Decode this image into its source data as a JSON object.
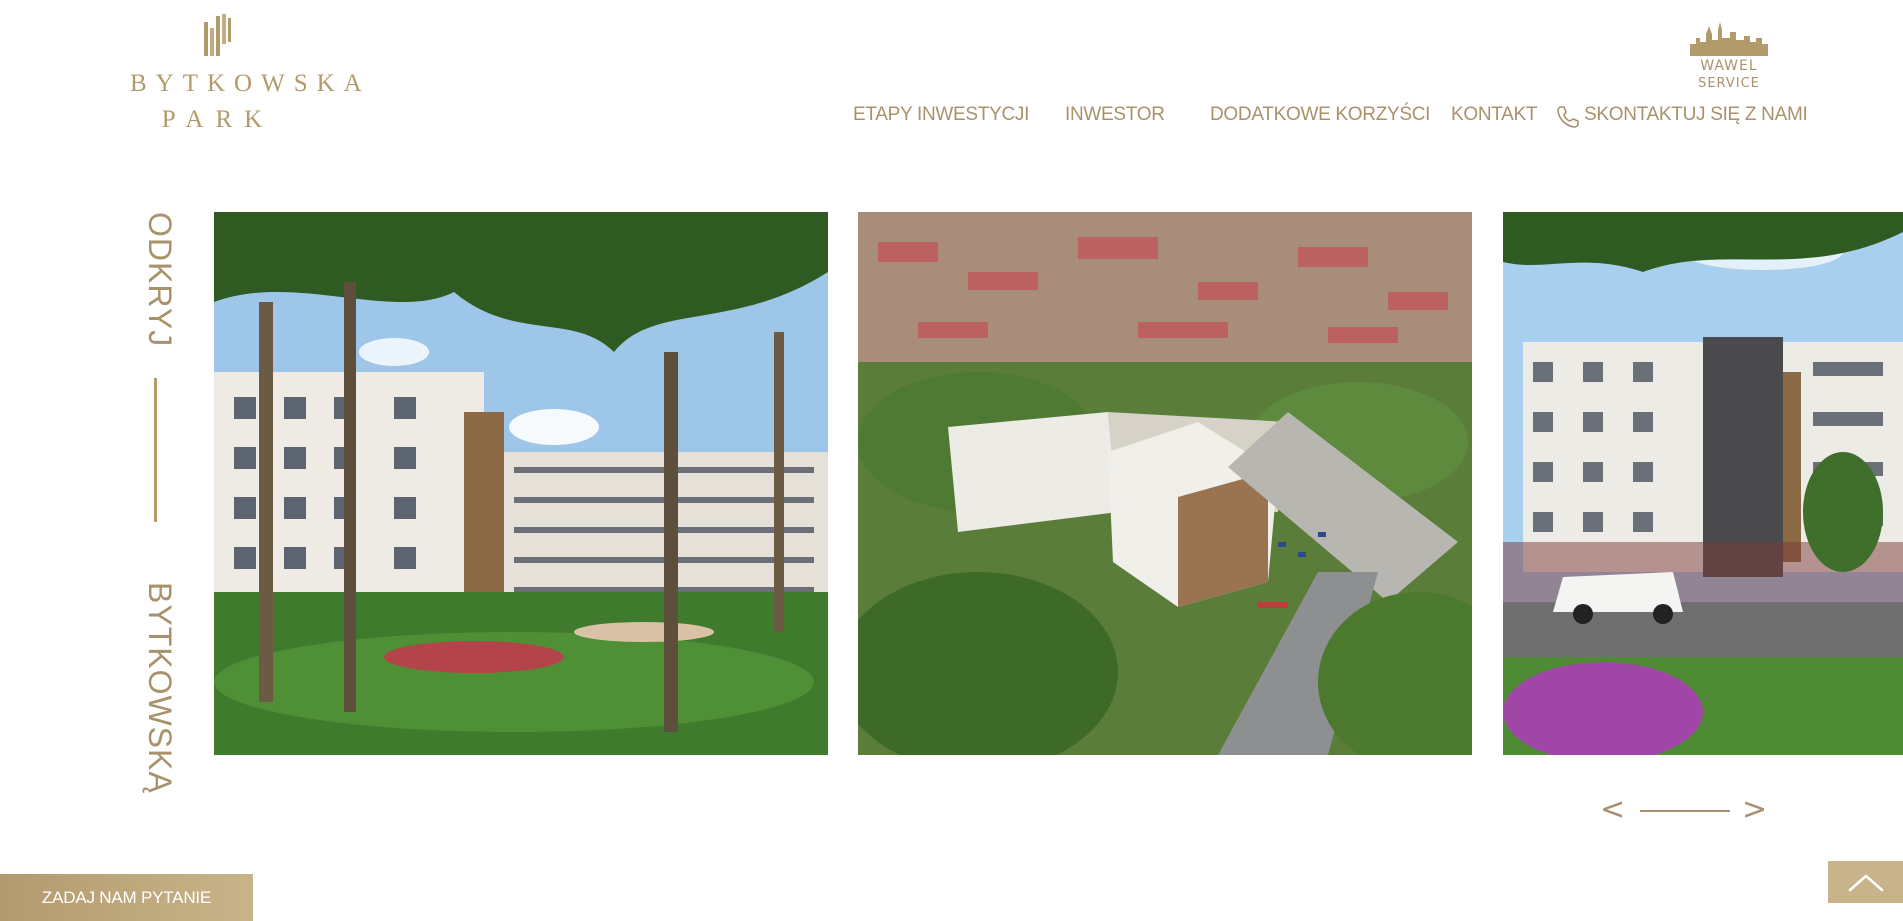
{
  "brand": {
    "name_line1": "BYTKOWSKA",
    "name_line2": "PARK",
    "partner_line1": "WAWEL",
    "partner_line2": "SERVICE",
    "accent_color": "#a8926b"
  },
  "nav": {
    "items": [
      {
        "label": "ETAPY INWESTYCJI"
      },
      {
        "label": "INWESTOR"
      },
      {
        "label": "DODATKOWE KORZYŚCI"
      },
      {
        "label": "KONTAKT"
      }
    ],
    "contact_label": "SKONTAKTUJ SIĘ Z NAMI",
    "contact_icon": "phone-icon"
  },
  "side": {
    "top": "ODKRYJ",
    "bottom": "BYTKOWSKĄ"
  },
  "slider": {
    "prev": "<",
    "next": ">",
    "slides": [
      {
        "scene": "courtyard-garden"
      },
      {
        "scene": "aerial-view"
      },
      {
        "scene": "street-view"
      }
    ]
  },
  "cta": {
    "ask": "ZADAJ NAM PYTANIE",
    "top_icon": "chevron-up-icon"
  }
}
